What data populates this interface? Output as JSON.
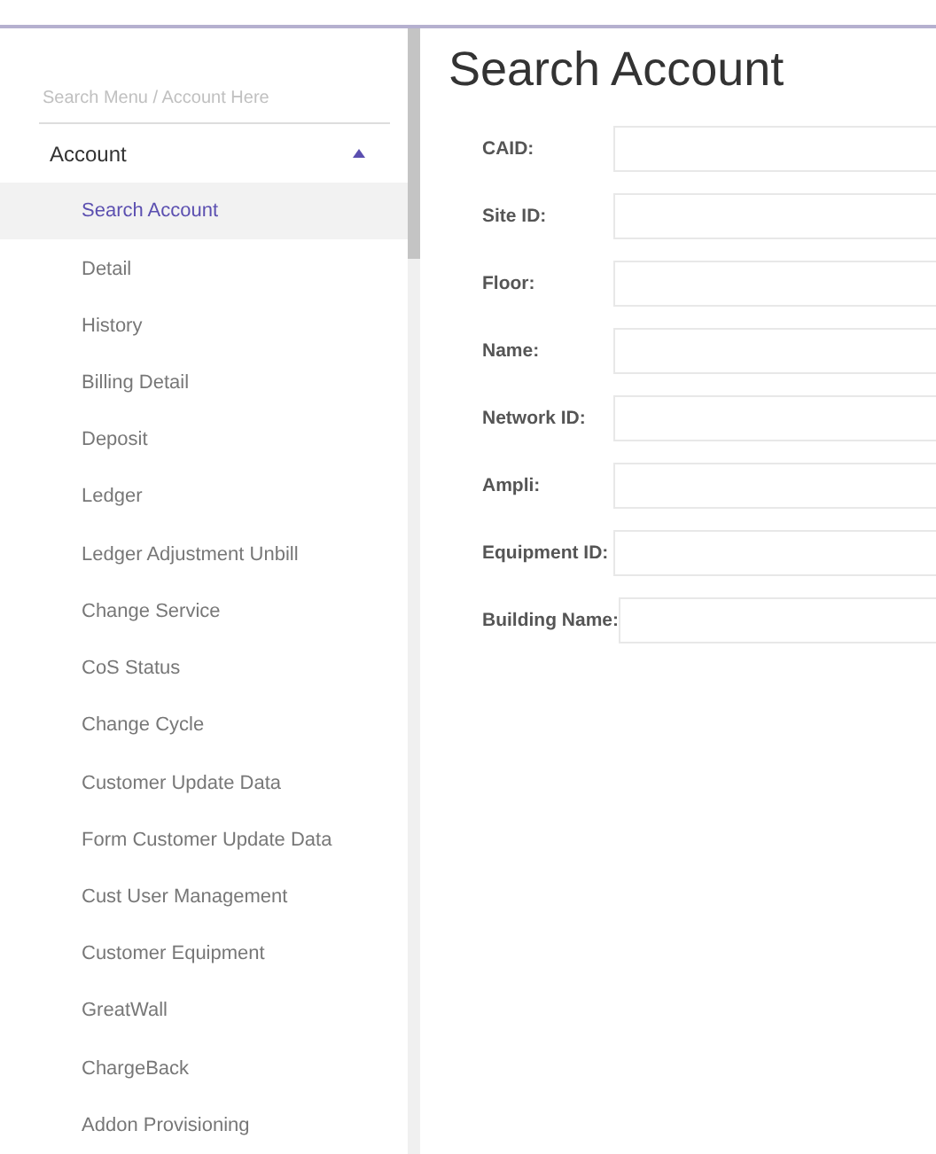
{
  "sidebar": {
    "search": {
      "placeholder": "Search Menu / Account Here"
    },
    "group": {
      "label": "Account",
      "expanded": true,
      "items": [
        {
          "label": "Search Account",
          "selected": true
        },
        {
          "label": "Detail",
          "selected": false
        },
        {
          "label": "History",
          "selected": false
        },
        {
          "label": "Billing Detail",
          "selected": false
        },
        {
          "label": "Deposit",
          "selected": false
        },
        {
          "label": "Ledger",
          "selected": false
        },
        {
          "label": "Ledger Adjustment Unbill",
          "selected": false
        },
        {
          "label": "Change Service",
          "selected": false
        },
        {
          "label": "CoS Status",
          "selected": false
        },
        {
          "label": "Change Cycle",
          "selected": false
        },
        {
          "label": "Customer Update Data",
          "selected": false
        },
        {
          "label": "Form Customer Update Data",
          "selected": false
        },
        {
          "label": "Cust User Management",
          "selected": false
        },
        {
          "label": "Customer Equipment",
          "selected": false
        },
        {
          "label": "GreatWall",
          "selected": false
        },
        {
          "label": "ChargeBack",
          "selected": false
        },
        {
          "label": "Addon Provisioning",
          "selected": false
        }
      ]
    }
  },
  "main": {
    "title": "Search Account",
    "fields": [
      {
        "label": "CAID:"
      },
      {
        "label": "Site ID:"
      },
      {
        "label": "Floor:"
      },
      {
        "label": "Name:"
      },
      {
        "label": "Network ID:"
      },
      {
        "label": "Ampli:"
      },
      {
        "label": "Equipment ID:"
      },
      {
        "label": "Building Name:"
      }
    ]
  }
}
